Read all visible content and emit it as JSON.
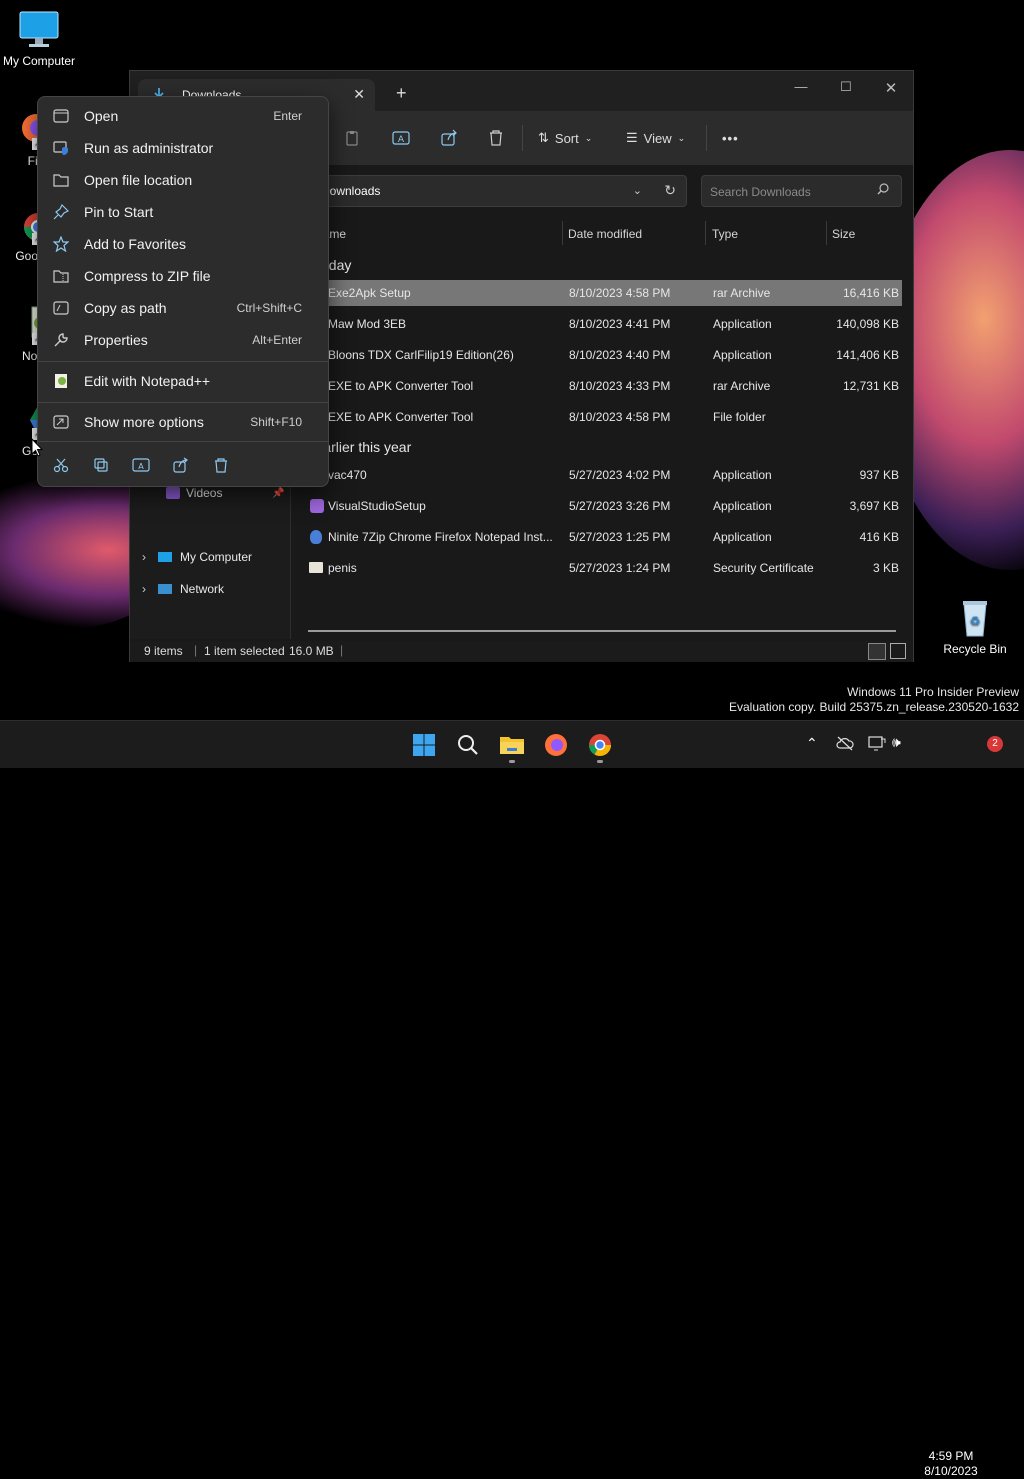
{
  "desktop": {
    "icons": [
      {
        "label": "My Computer"
      },
      {
        "label": "Fire"
      },
      {
        "label": "Goo Chr"
      },
      {
        "label": "Notep"
      },
      {
        "label": "Googl"
      },
      {
        "label": "Recycle Bin"
      }
    ],
    "watermark": {
      "line1": "Windows 11 Pro Insider Preview",
      "line2": "Evaluation copy. Build 25375.zn_release.230520-1632"
    }
  },
  "explorer": {
    "tab_title": "Downloads",
    "toolbar": {
      "sort_label": "Sort",
      "view_label": "View",
      "more_label": "•••"
    },
    "address": "Downloads",
    "search_placeholder": "Search Downloads",
    "columns": {
      "name": "Name",
      "date": "Date modified",
      "type": "Type",
      "size": "Size"
    },
    "groups": {
      "today": "Today",
      "earlier": "Earlier this year"
    },
    "files_today": [
      {
        "name": "Exe2Apk Setup",
        "date": "8/10/2023 4:58 PM",
        "type": "rar Archive",
        "size": "16,416 KB"
      },
      {
        "name": "Maw Mod 3EB",
        "date": "8/10/2023 4:41 PM",
        "type": "Application",
        "size": "140,098 KB"
      },
      {
        "name": "Bloons TDX CarlFilip19 Edition(26)",
        "date": "8/10/2023 4:40 PM",
        "type": "Application",
        "size": "141,406 KB"
      },
      {
        "name": "EXE to APK Converter Tool",
        "date": "8/10/2023 4:33 PM",
        "type": "rar Archive",
        "size": "12,731 KB"
      },
      {
        "name": "EXE to APK Converter Tool",
        "date": "8/10/2023 4:58 PM",
        "type": "File folder",
        "size": ""
      }
    ],
    "files_earlier": [
      {
        "name": "vac470",
        "date": "5/27/2023 4:02 PM",
        "type": "Application",
        "size": "937 KB"
      },
      {
        "name": "VisualStudioSetup",
        "date": "5/27/2023 3:26 PM",
        "type": "Application",
        "size": "3,697 KB"
      },
      {
        "name": "Ninite 7Zip Chrome Firefox Notepad Inst...",
        "date": "5/27/2023 1:25 PM",
        "type": "Application",
        "size": "416 KB"
      },
      {
        "name": "penis",
        "date": "5/27/2023 1:24 PM",
        "type": "Security Certificate",
        "size": "3 KB"
      }
    ],
    "nav": {
      "videos": "Videos",
      "my_computer": "My Computer",
      "network": "Network"
    },
    "status": {
      "items": "9 items",
      "selected": "1 item selected",
      "size": "16.0 MB"
    }
  },
  "context_menu": {
    "items": [
      {
        "label": "Open",
        "shortcut": "Enter"
      },
      {
        "label": "Run as administrator",
        "shortcut": ""
      },
      {
        "label": "Open file location",
        "shortcut": ""
      },
      {
        "label": "Pin to Start",
        "shortcut": ""
      },
      {
        "label": "Add to Favorites",
        "shortcut": ""
      },
      {
        "label": "Compress to ZIP file",
        "shortcut": ""
      },
      {
        "label": "Copy as path",
        "shortcut": "Ctrl+Shift+C"
      },
      {
        "label": "Properties",
        "shortcut": "Alt+Enter"
      },
      {
        "label": "Edit with Notepad++",
        "shortcut": ""
      },
      {
        "label": "Show more options",
        "shortcut": "Shift+F10"
      }
    ]
  },
  "taskbar": {
    "time": "4:59 PM",
    "date": "8/10/2023",
    "notification_count": "2"
  },
  "colors": {
    "accent": "#4cc2ff",
    "selection": "#777777",
    "menu_bg": "#2c2c2c"
  }
}
